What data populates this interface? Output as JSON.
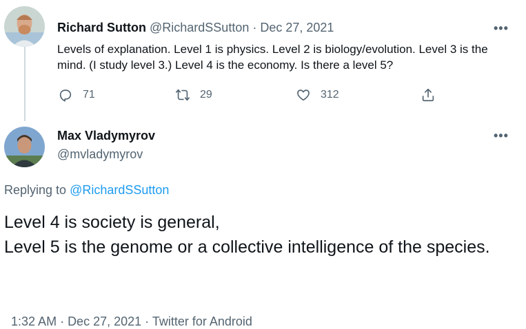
{
  "parent_tweet": {
    "author_name": "Richard Sutton",
    "author_handle": "@RichardSSutton",
    "separator": "·",
    "date": "Dec 27, 2021",
    "more_label": "•••",
    "text": "Levels of explanation. Level 1 is physics. Level 2 is biology/evolution. Level 3 is the mind. (I study level 3.) Level 4 is the economy. Is there a level 5?",
    "actions": {
      "reply_count": "71",
      "retweet_count": "29",
      "like_count": "312"
    }
  },
  "reply_tweet": {
    "author_name": "Max Vladymyrov",
    "author_handle": "@mvladymyrov",
    "more_label": "•••",
    "replying_to_prefix": "Replying to ",
    "replying_to_handle": "@RichardSSutton",
    "text_line1": "Level 4 is society is general,",
    "text_line2": "Level 5 is the genome or a collective intelligence of the species.",
    "meta": {
      "time": "1:32 AM",
      "separator1": " · ",
      "date": "Dec 27, 2021",
      "separator2": " · ",
      "client": "Twitter for Android"
    }
  },
  "colors": {
    "link": "#1d9bf0",
    "muted": "#536471",
    "text": "#0f1419",
    "thread_line": "#cfd9de"
  },
  "icons": [
    "reply-icon",
    "retweet-icon",
    "like-icon",
    "share-icon",
    "more-icon"
  ]
}
